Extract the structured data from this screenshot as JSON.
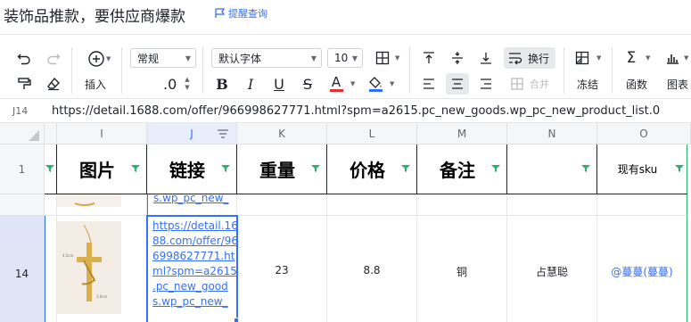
{
  "title": "装饰品推款，要供应商爆款",
  "reminder_label": "提醒查询",
  "toolbar": {
    "format_value": "常规",
    "font_value": "默认字体",
    "size_value": "10",
    "insert_label": "插入",
    "decimal_label": ".0",
    "wrap_label": "换行",
    "merge_label": "合并",
    "freeze_label": "冻结",
    "function_label": "函数",
    "chart_label": "图表"
  },
  "formula_bar": {
    "cell_ref": "J14",
    "value": "https://detail.1688.com/offer/966998627771.html?spm=a2615.pc_new_goods.wp_pc_new_product_list.0"
  },
  "columns": [
    "I",
    "J",
    "K",
    "L",
    "M",
    "N",
    "O"
  ],
  "rows": {
    "header_row_num": "1",
    "data_row_num": "14"
  },
  "headers": {
    "image": "图片",
    "link": "链接",
    "weight": "重量",
    "price": "价格",
    "note": "备注",
    "n": "",
    "stock": "现有sku"
  },
  "partial_row": {
    "link_text": "s.wp_pc_new_"
  },
  "data_row": {
    "link_lines": [
      "https://detail.16",
      "88.com/offer/96",
      "6998627771.ht",
      "ml?spm=a2615",
      ".pc_new_good",
      "s.wp_pc_new_"
    ],
    "weight": "23",
    "price": "8.8",
    "note": "铜",
    "owner": "占慧聪",
    "mention": "@蔓蔓(蔓蔓)"
  },
  "colors": {
    "accent": "#3370ff",
    "filter": "#2fb06a"
  }
}
